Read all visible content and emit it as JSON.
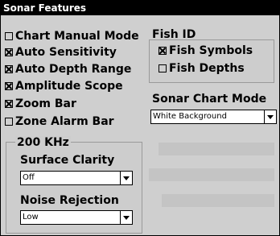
{
  "window": {
    "title": "Sonar Features"
  },
  "options": [
    {
      "label": "Chart Manual Mode",
      "checked": false
    },
    {
      "label": "Auto Sensitivity",
      "checked": true
    },
    {
      "label": "Auto Depth Range",
      "checked": true
    },
    {
      "label": "Amplitude Scope",
      "checked": true
    },
    {
      "label": "Zoom Bar",
      "checked": true
    },
    {
      "label": "Zone Alarm Bar",
      "checked": false
    }
  ],
  "fish_id": {
    "title": "Fish ID",
    "options": [
      {
        "label": "Fish Symbols",
        "checked": true
      },
      {
        "label": "Fish Depths",
        "checked": false
      }
    ]
  },
  "sonar_chart_mode": {
    "label": "Sonar Chart Mode",
    "value": "White Background"
  },
  "khz200": {
    "title": "200 KHz",
    "surface_clarity": {
      "label": "Surface Clarity",
      "value": "Off"
    },
    "noise_rejection": {
      "label": "Noise Rejection",
      "value": "Low"
    }
  }
}
